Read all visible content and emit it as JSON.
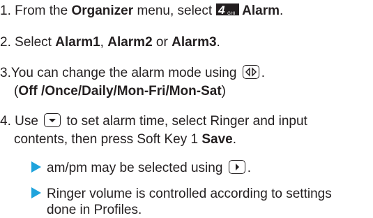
{
  "steps": {
    "s1": {
      "num": "1.",
      "pre": "From the",
      "menu": "Organizer",
      "mid": "menu, select",
      "badge_num": "4",
      "badge_sub": "GHI",
      "item": "Alarm",
      "end": "."
    },
    "s2": {
      "num": "2.",
      "pre": "Select",
      "a1": "Alarm1",
      "sep1": ",",
      "a2": "Alarm2",
      "or": "or",
      "a3": "Alarm3",
      "end": "."
    },
    "s3": {
      "num": "3.",
      "text": "You can change the alarm mode using",
      "end": ".",
      "open": "(",
      "modes": "Off /Once/Daily/Mon-Fri/Mon-Sat",
      "close": ")"
    },
    "s4": {
      "num": "4.",
      "pre": "Use",
      "post": "to set alarm time, select Ringer and input",
      "line2": "contents, then press Soft Key 1",
      "save": "Save",
      "end": "."
    }
  },
  "notes": [
    {
      "text": "am/pm may be selected using",
      "end": "."
    },
    {
      "line1": "Ringer volume is controlled according to settings",
      "line2": "done in Profiles."
    }
  ],
  "icons": {
    "bullet": "triangle-bullet-icon",
    "nav_lr": "navigation-left-right-key-icon",
    "nav_down": "navigation-down-key-icon",
    "nav_right": "navigation-right-key-icon",
    "menu_badge": "keypad-4-ghi-icon"
  },
  "colors": {
    "text": "#231f20",
    "bullet": "#1fa3dc"
  }
}
